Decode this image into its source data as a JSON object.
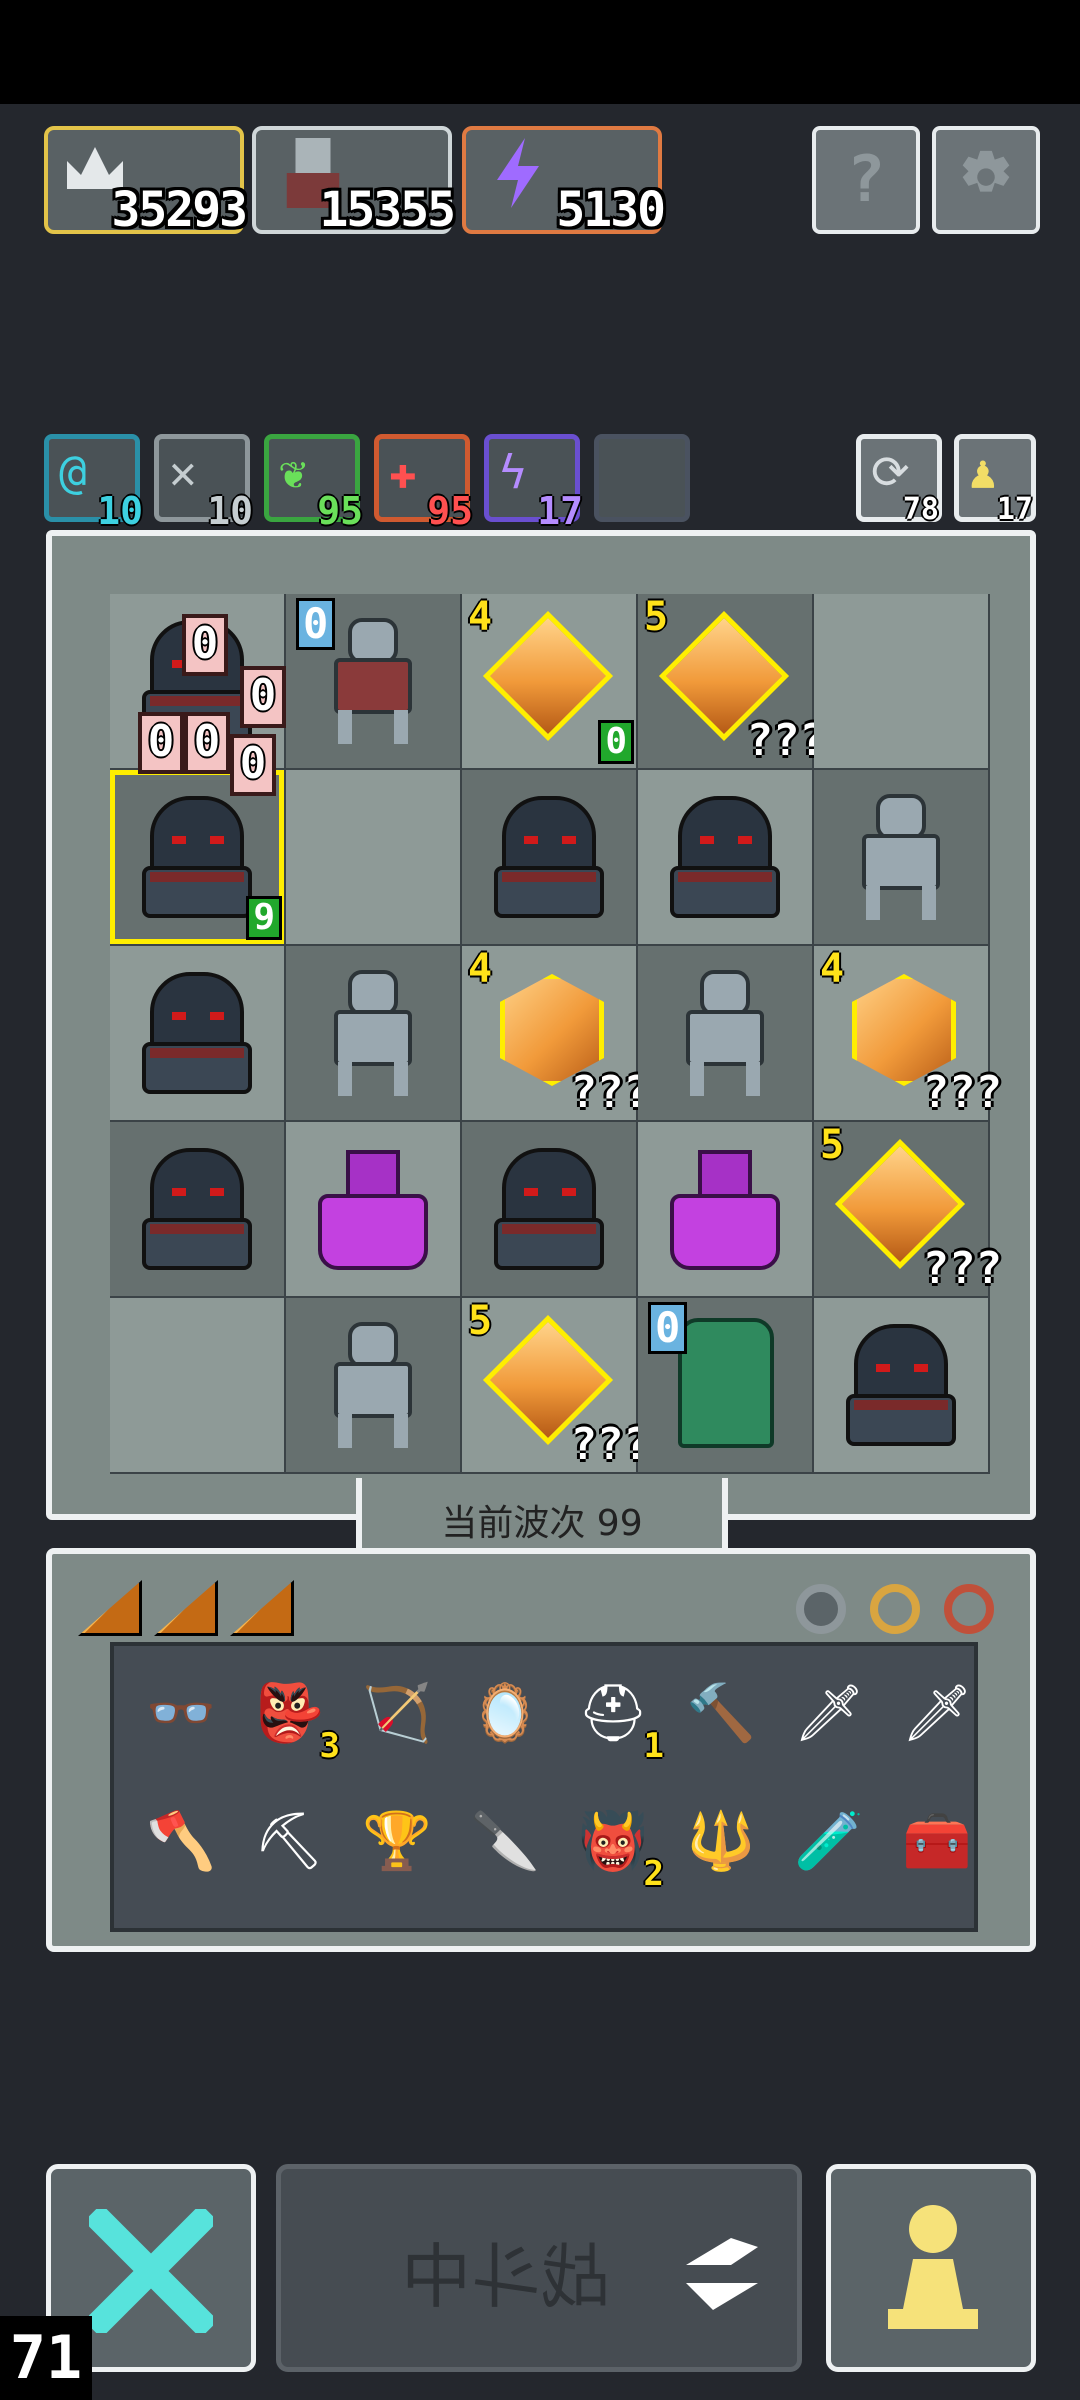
{
  "resources": [
    {
      "name": "crown",
      "value": "35293",
      "border": "#e3c449"
    },
    {
      "name": "knight",
      "value": "15355",
      "border": "#cfd6d8"
    },
    {
      "name": "energy",
      "value": "5130",
      "border": "#e07a42"
    }
  ],
  "top_buttons": {
    "help": "?",
    "settings": "⚙"
  },
  "stats": [
    {
      "icon": "spiral-icon",
      "value": "10",
      "color": "#3dd0e0",
      "border": "#2a90a8"
    },
    {
      "icon": "crossed-swords-icon",
      "value": "10",
      "color": "#c5cdd0",
      "border": "#8e979b"
    },
    {
      "icon": "leaf-icon",
      "value": "95",
      "color": "#6ae05a",
      "border": "#3aa540"
    },
    {
      "icon": "plus-icon",
      "value": "95",
      "color": "#ff5050",
      "border": "#d05a30"
    },
    {
      "icon": "lightning-icon",
      "value": "17",
      "color": "#b58cff",
      "border": "#6a4fd0"
    },
    {
      "icon": "empty-slot",
      "value": "",
      "color": "#fff",
      "border": "#4a5260"
    }
  ],
  "right_counters": [
    {
      "icon": "refresh-icon",
      "value": "78"
    },
    {
      "icon": "pawn-icon",
      "value": "17"
    }
  ],
  "board": {
    "cells": [
      [
        "hero",
        "knight",
        "gem4_0",
        "gem5_q",
        ""
      ],
      [
        "hero_hit",
        "",
        "hood",
        "hood",
        "skel"
      ],
      [
        "hood",
        "skel",
        "gem4_q",
        "skel",
        "gem4_q2"
      ],
      [
        "hood",
        "demon",
        "hood",
        "demon",
        "gem5_q2"
      ],
      [
        "",
        "skel",
        "gem5_q3",
        "plant",
        "hood"
      ]
    ],
    "damage_digits": [
      "0",
      "0",
      "0",
      "0",
      "0"
    ],
    "knight_badge": "0",
    "hero_hit_count": "9",
    "gem_levels": {
      "four": "4",
      "five": "5"
    },
    "gem_count": "0",
    "unknown": "???",
    "plant_badge": "0"
  },
  "wave": {
    "label": "当前波次 99"
  },
  "inventory": {
    "cards": [
      "card-icon",
      "card-icon",
      "card-icon"
    ],
    "accessories": [
      "armor-icon",
      "ring-gold-icon",
      "ring-red-icon"
    ],
    "row1": [
      {
        "icon": "goggles-icon",
        "glyph": "👓",
        "count": ""
      },
      {
        "icon": "goblin-icon",
        "glyph": "👺",
        "count": "3"
      },
      {
        "icon": "slingshot-icon",
        "glyph": "🏹",
        "count": ""
      },
      {
        "icon": "mirror-icon",
        "glyph": "🪞",
        "count": ""
      },
      {
        "icon": "helmet-icon",
        "glyph": "⛑",
        "count": "1"
      },
      {
        "icon": "hammer-icon",
        "glyph": "🔨",
        "count": ""
      },
      {
        "icon": "pink-sword-icon",
        "glyph": "🗡",
        "count": ""
      },
      {
        "icon": "blue-sword-icon",
        "glyph": "🗡",
        "count": ""
      }
    ],
    "row2": [
      {
        "icon": "orange-axe-icon",
        "glyph": "🪓",
        "count": ""
      },
      {
        "icon": "silver-axe-icon",
        "glyph": "⛏",
        "count": ""
      },
      {
        "icon": "chalice-icon",
        "glyph": "🏆",
        "count": ""
      },
      {
        "icon": "dagger-icon",
        "glyph": "🔪",
        "count": ""
      },
      {
        "icon": "red-mask-icon",
        "glyph": "👹",
        "count": "2"
      },
      {
        "icon": "spear-icon",
        "glyph": "🔱",
        "count": ""
      },
      {
        "icon": "potion-icon",
        "glyph": "🧪",
        "count": ""
      },
      {
        "icon": "chest-mimic-icon",
        "glyph": "🧰",
        "count": ""
      }
    ]
  },
  "bottom": {
    "battle_label": "战斗中",
    "level": "71"
  }
}
